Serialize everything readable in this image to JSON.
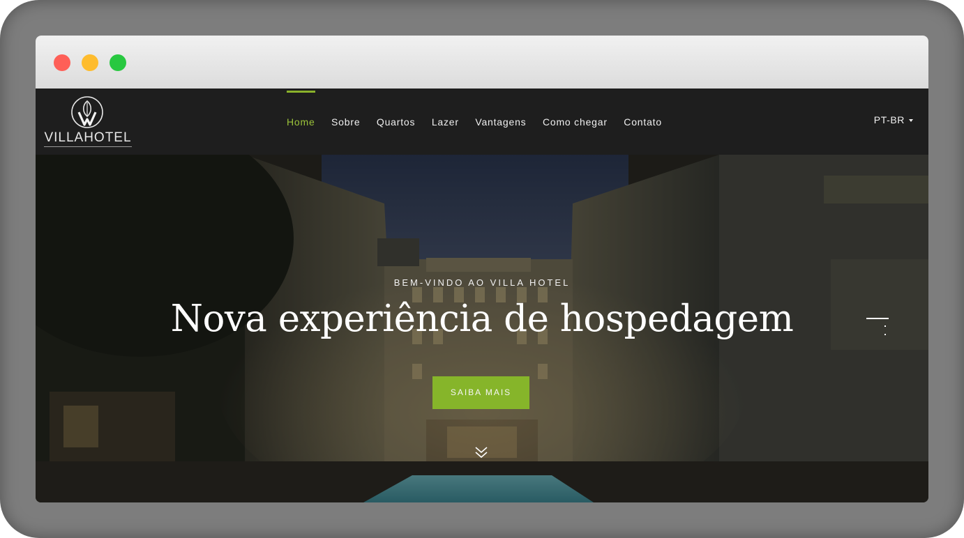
{
  "site": {
    "logo_text_villa": "VILLA",
    "logo_text_hotel": "HOTEL"
  },
  "nav": {
    "items": [
      {
        "label": "Home",
        "active": true
      },
      {
        "label": "Sobre",
        "active": false
      },
      {
        "label": "Quartos",
        "active": false
      },
      {
        "label": "Lazer",
        "active": false
      },
      {
        "label": "Vantagens",
        "active": false
      },
      {
        "label": "Como chegar",
        "active": false
      },
      {
        "label": "Contato",
        "active": false
      }
    ],
    "language": "PT-BR"
  },
  "hero": {
    "subtitle": "BEM-VINDO AO VILLA HOTEL",
    "title": "Nova experiência de hospedagem",
    "button_label": "SAIBA MAIS"
  },
  "colors": {
    "accent": "#86b52a",
    "nav_bg": "#1e1e1e"
  },
  "icons": {
    "logo": "leaf-v-icon",
    "scroll": "chevron-double-down-icon",
    "menu": "menu-lines-icon",
    "language_caret": "caret-down-icon"
  }
}
